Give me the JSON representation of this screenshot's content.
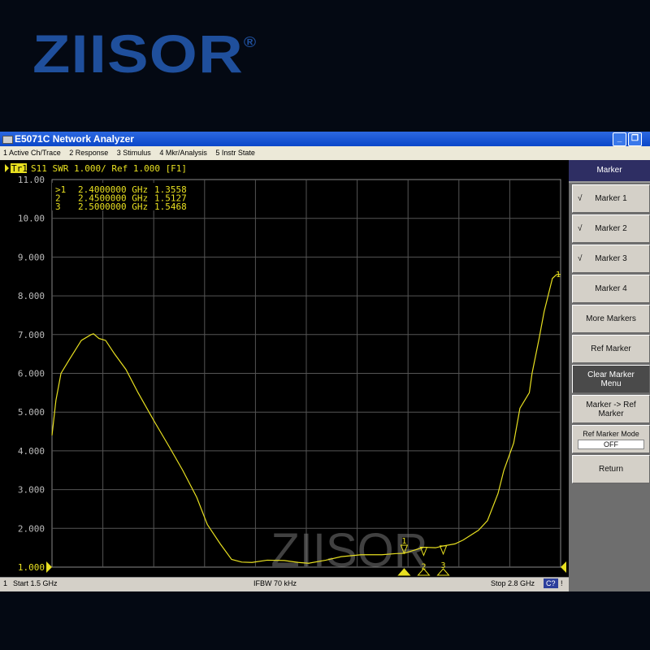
{
  "logo": "ZIISOR",
  "logo_mark": "®",
  "window": {
    "title": "E5071C Network Analyzer",
    "minimize": "_",
    "restore": "❐"
  },
  "menu": [
    "1 Active Ch/Trace",
    "2 Response",
    "3 Stimulus",
    "4 Mkr/Analysis",
    "5 Instr State"
  ],
  "trace_header": {
    "tag": "Tr1",
    "text": "S11  SWR 1.000/ Ref 1.000 [F1]"
  },
  "markers": [
    {
      "label": ">1",
      "freq": "2.4000000 GHz",
      "value": "1.3558",
      "f": 2.4,
      "v": 1.3558
    },
    {
      "label": " 2",
      "freq": "2.4500000 GHz",
      "value": "1.5127",
      "f": 2.45,
      "v": 1.5127
    },
    {
      "label": " 3",
      "freq": "2.5000000 GHz",
      "value": "1.5468",
      "f": 2.5,
      "v": 1.5468
    }
  ],
  "status": {
    "channel": "1",
    "start": "Start 1.5 GHz",
    "ifbw": "IFBW 70 kHz",
    "stop": "Stop 2.8 GHz",
    "cal": "C?",
    "flag": "!"
  },
  "panel": {
    "header": "Marker",
    "buttons": [
      {
        "label": "Marker 1",
        "check": "√"
      },
      {
        "label": "Marker 2",
        "check": "√"
      },
      {
        "label": "Marker 3",
        "check": "√"
      },
      {
        "label": "Marker 4",
        "check": ""
      },
      {
        "label": "More Markers",
        "check": ""
      },
      {
        "label": "Ref Marker",
        "check": ""
      },
      {
        "label": "Clear Marker Menu",
        "check": "",
        "dark": true
      },
      {
        "label": "Marker -> Ref Marker",
        "check": ""
      }
    ],
    "mode_label": "Ref Marker Mode",
    "mode_value": "OFF",
    "return": "Return"
  },
  "watermark": "ZIISOR",
  "chart_data": {
    "type": "line",
    "title": "S11 SWR",
    "xlim": [
      1.5,
      2.8
    ],
    "ylim": [
      1.0,
      11.0
    ],
    "yticks": [
      "11.00",
      "10.00",
      "9.000",
      "8.000",
      "7.000",
      "6.000",
      "5.000",
      "4.000",
      "3.000",
      "2.000",
      "1.000"
    ],
    "x": [
      1.5,
      1.51,
      1.523,
      1.544,
      1.575,
      1.6,
      1.606,
      1.62,
      1.637,
      1.66,
      1.689,
      1.72,
      1.762,
      1.8,
      1.834,
      1.87,
      1.897,
      1.93,
      1.959,
      1.985,
      2.011,
      2.05,
      2.094,
      2.13,
      2.156,
      2.2,
      2.239,
      2.29,
      2.343,
      2.38,
      2.4,
      2.43,
      2.45,
      2.48,
      2.5,
      2.53,
      2.551,
      2.59,
      2.613,
      2.64,
      2.655,
      2.68,
      2.696,
      2.72,
      2.727,
      2.745,
      2.758,
      2.779,
      2.79,
      2.8
    ],
    "y": [
      4.4,
      5.3,
      6.0,
      6.35,
      6.85,
      7.0,
      7.02,
      6.9,
      6.85,
      6.5,
      6.1,
      5.5,
      4.75,
      4.1,
      3.5,
      2.8,
      2.1,
      1.6,
      1.2,
      1.13,
      1.12,
      1.18,
      1.17,
      1.12,
      1.1,
      1.18,
      1.27,
      1.32,
      1.32,
      1.35,
      1.3558,
      1.45,
      1.5127,
      1.5,
      1.5468,
      1.6,
      1.7,
      1.95,
      2.2,
      2.9,
      3.5,
      4.2,
      5.1,
      5.5,
      6.0,
      6.9,
      7.6,
      8.45,
      8.55,
      8.55
    ],
    "series_color": "#e8e020"
  }
}
